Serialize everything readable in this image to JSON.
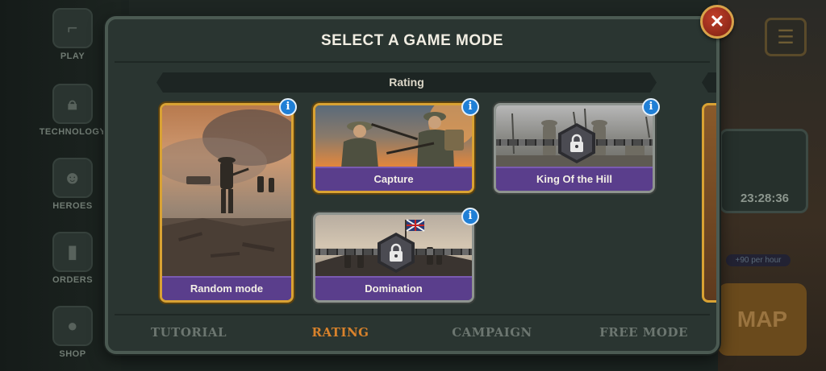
{
  "background": {
    "nav": [
      {
        "label": "PLAY",
        "icon": "gun-icon"
      },
      {
        "label": "TECHNOLOGY",
        "icon": "lock-icon"
      },
      {
        "label": "HEROES",
        "icon": "soldier-icon"
      },
      {
        "label": "ORDERS",
        "icon": "cards-icon"
      },
      {
        "label": "SHOP",
        "icon": "coins-icon"
      }
    ],
    "timer": "23:28:36",
    "hint": "+90 per hour",
    "map_button": "MAP"
  },
  "modal": {
    "title": "SELECT A GAME MODE",
    "close_label": "✕",
    "section": "Rating",
    "cards": [
      {
        "label": "Random mode",
        "locked": false,
        "info": "i"
      },
      {
        "label": "Capture",
        "locked": false,
        "info": "i"
      },
      {
        "label": "King Of the Hill",
        "locked": true,
        "info": "i"
      },
      {
        "label": "Domination",
        "locked": true,
        "info": "i"
      }
    ],
    "tabs": [
      {
        "label": "TUTORIAL",
        "active": false
      },
      {
        "label": "RATING",
        "active": true
      },
      {
        "label": "CAMPAIGN",
        "active": false
      },
      {
        "label": "FREE MODE",
        "active": false
      }
    ]
  },
  "colors": {
    "accent_gold": "#d9a233",
    "label_purple": "#5a3e8c",
    "active_tab": "#d9822b",
    "info_blue": "#1f7fd6",
    "close_red": "#a8321f"
  }
}
